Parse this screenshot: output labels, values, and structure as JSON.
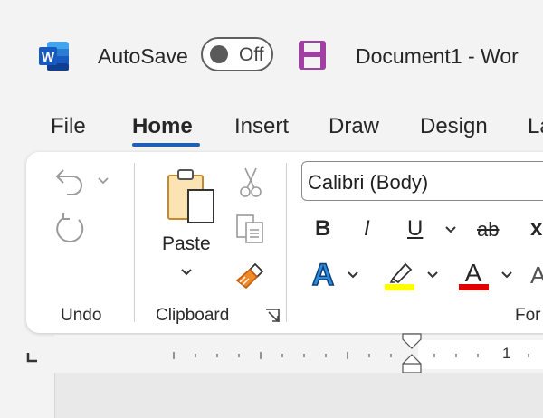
{
  "titlebar": {
    "autosave_label": "AutoSave",
    "autosave_state": "Off",
    "document_title": "Document1  -  Wor",
    "word_logo_letter": "W",
    "word_logo_color": "#185abd",
    "save_icon_color": "#a13fa3"
  },
  "tabs": [
    {
      "label": "File"
    },
    {
      "label": "Home",
      "active": true
    },
    {
      "label": "Insert"
    },
    {
      "label": "Draw"
    },
    {
      "label": "Design"
    },
    {
      "label": "La"
    }
  ],
  "ribbon": {
    "undo_group": {
      "label": "Undo",
      "undo_icon": "undo-icon",
      "redo_icon": "redo-icon"
    },
    "clipboard_group": {
      "label": "Clipboard",
      "paste_label": "Paste",
      "icons": [
        "paste-icon",
        "cut-icon",
        "copy-icon",
        "format-painter-icon",
        "dialog-launcher-icon"
      ]
    },
    "font_group": {
      "label": "For",
      "font_name": "Calibri (Body)",
      "bold": "B",
      "italic": "I",
      "underline": "U",
      "strikethrough": "ab",
      "subscript": "x",
      "text_effects_letter": "A",
      "highlight_color": "#ffff00",
      "font_color_letter": "A",
      "font_color": "#e00000",
      "partial_letter": "A"
    }
  },
  "ruler": {
    "number": "1"
  }
}
